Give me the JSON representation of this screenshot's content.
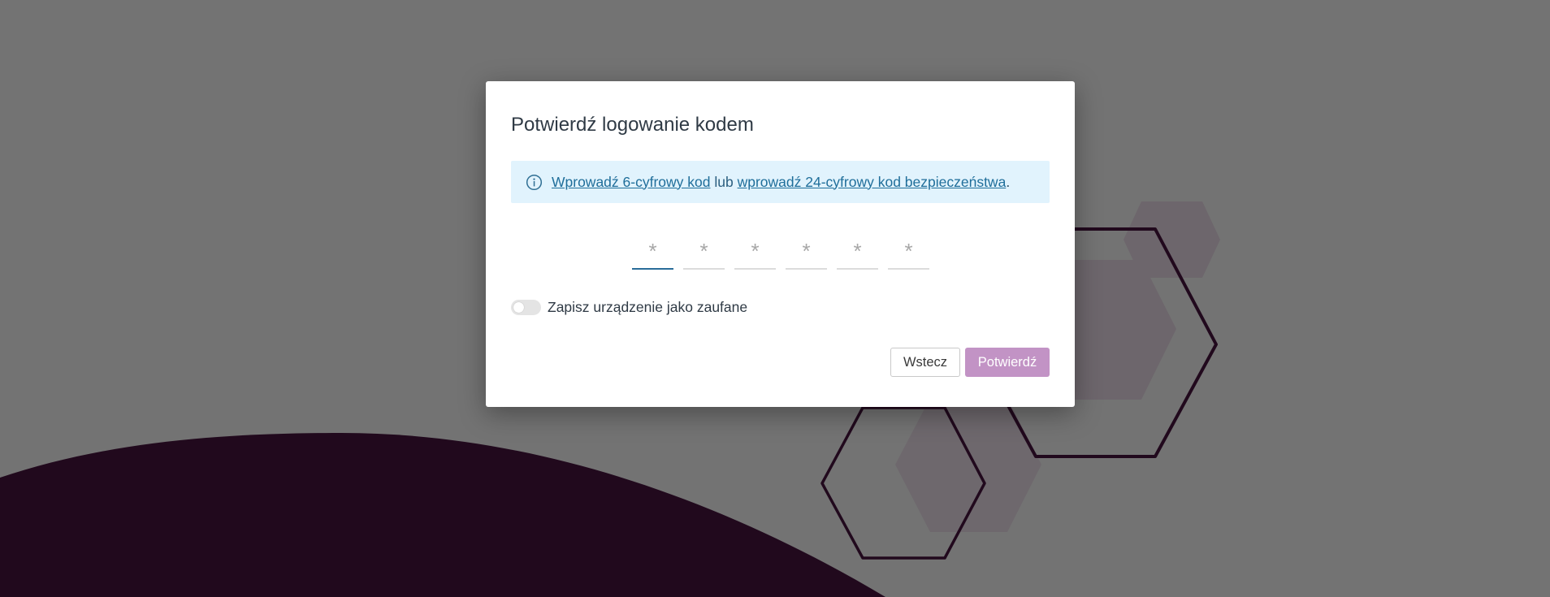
{
  "dialog": {
    "title": "Potwierdź logowanie kodem",
    "info": {
      "link_6_digit": "Wprowadź 6-cyfrowy kod",
      "separator": "lub",
      "link_24_digit": "wprowadź 24-cyfrowy kod bezpieczeństwa",
      "trailing": "."
    },
    "code_inputs": {
      "placeholder": "*",
      "values": [
        "",
        "",
        "",
        "",
        "",
        ""
      ]
    },
    "trust_device": {
      "label": "Zapisz urządzenie jako zaufane",
      "enabled": false
    },
    "buttons": {
      "back_label": "Wstecz",
      "confirm_label": "Potwierdź"
    }
  },
  "colors": {
    "brand_dark": "#4a1540",
    "confirm_button": "#c293c5",
    "info_background": "#e1f3fd",
    "link": "#1f6e9a",
    "active_underline": "#2a6d99"
  },
  "icons": {
    "info": "info-circle-icon"
  }
}
